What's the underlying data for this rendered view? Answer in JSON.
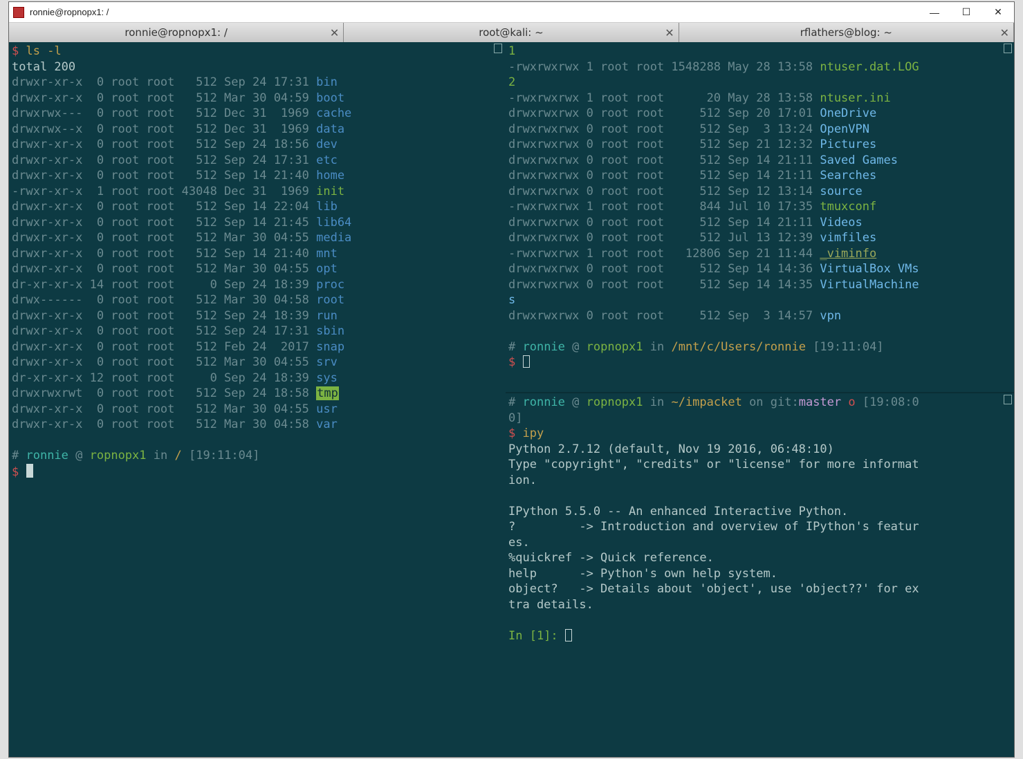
{
  "window": {
    "title": "ronnie@ropnopx1: /"
  },
  "tabs": [
    {
      "label": "ronnie@ropnopx1: /"
    },
    {
      "label": "root@kali: ~"
    },
    {
      "label": "rflathers@blog: ~"
    }
  ],
  "left": {
    "cmd": "ls -l",
    "total": "total 200",
    "rows": [
      {
        "perm": "drwxr-xr-x",
        "n": "0",
        "o": "root",
        "g": "root",
        "size": "512",
        "date": "Sep 24 17:31",
        "name": "bin",
        "cls": "c-blue"
      },
      {
        "perm": "drwxr-xr-x",
        "n": "0",
        "o": "root",
        "g": "root",
        "size": "512",
        "date": "Mar 30 04:59",
        "name": "boot",
        "cls": "c-blue"
      },
      {
        "perm": "drwxrwx---",
        "n": "0",
        "o": "root",
        "g": "root",
        "size": "512",
        "date": "Dec 31  1969",
        "name": "cache",
        "cls": "c-blue"
      },
      {
        "perm": "drwxrwx--x",
        "n": "0",
        "o": "root",
        "g": "root",
        "size": "512",
        "date": "Dec 31  1969",
        "name": "data",
        "cls": "c-blue"
      },
      {
        "perm": "drwxr-xr-x",
        "n": "0",
        "o": "root",
        "g": "root",
        "size": "512",
        "date": "Sep 24 18:56",
        "name": "dev",
        "cls": "c-blue"
      },
      {
        "perm": "drwxr-xr-x",
        "n": "0",
        "o": "root",
        "g": "root",
        "size": "512",
        "date": "Sep 24 17:31",
        "name": "etc",
        "cls": "c-blue"
      },
      {
        "perm": "drwxr-xr-x",
        "n": "0",
        "o": "root",
        "g": "root",
        "size": "512",
        "date": "Sep 14 21:40",
        "name": "home",
        "cls": "c-blue"
      },
      {
        "perm": "-rwxr-xr-x",
        "n": "1",
        "o": "root",
        "g": "root",
        "size": "43048",
        "date": "Dec 31  1969",
        "name": "init",
        "cls": "c-green"
      },
      {
        "perm": "drwxr-xr-x",
        "n": "0",
        "o": "root",
        "g": "root",
        "size": "512",
        "date": "Sep 14 22:04",
        "name": "lib",
        "cls": "c-blue"
      },
      {
        "perm": "drwxr-xr-x",
        "n": "0",
        "o": "root",
        "g": "root",
        "size": "512",
        "date": "Sep 14 21:45",
        "name": "lib64",
        "cls": "c-blue"
      },
      {
        "perm": "drwxr-xr-x",
        "n": "0",
        "o": "root",
        "g": "root",
        "size": "512",
        "date": "Mar 30 04:55",
        "name": "media",
        "cls": "c-blue"
      },
      {
        "perm": "drwxr-xr-x",
        "n": "0",
        "o": "root",
        "g": "root",
        "size": "512",
        "date": "Sep 14 21:40",
        "name": "mnt",
        "cls": "c-blue"
      },
      {
        "perm": "drwxr-xr-x",
        "n": "0",
        "o": "root",
        "g": "root",
        "size": "512",
        "date": "Mar 30 04:55",
        "name": "opt",
        "cls": "c-blue"
      },
      {
        "perm": "dr-xr-xr-x",
        "n": "14",
        "o": "root",
        "g": "root",
        "size": "0",
        "date": "Sep 24 18:39",
        "name": "proc",
        "cls": "c-blue"
      },
      {
        "perm": "drwx------",
        "n": "0",
        "o": "root",
        "g": "root",
        "size": "512",
        "date": "Mar 30 04:58",
        "name": "root",
        "cls": "c-blue"
      },
      {
        "perm": "drwxr-xr-x",
        "n": "0",
        "o": "root",
        "g": "root",
        "size": "512",
        "date": "Sep 24 18:39",
        "name": "run",
        "cls": "c-blue"
      },
      {
        "perm": "drwxr-xr-x",
        "n": "0",
        "o": "root",
        "g": "root",
        "size": "512",
        "date": "Sep 24 17:31",
        "name": "sbin",
        "cls": "c-blue"
      },
      {
        "perm": "drwxr-xr-x",
        "n": "0",
        "o": "root",
        "g": "root",
        "size": "512",
        "date": "Feb 24  2017",
        "name": "snap",
        "cls": "c-blue"
      },
      {
        "perm": "drwxr-xr-x",
        "n": "0",
        "o": "root",
        "g": "root",
        "size": "512",
        "date": "Mar 30 04:55",
        "name": "srv",
        "cls": "c-blue"
      },
      {
        "perm": "dr-xr-xr-x",
        "n": "12",
        "o": "root",
        "g": "root",
        "size": "0",
        "date": "Sep 24 18:39",
        "name": "sys",
        "cls": "c-blue"
      },
      {
        "perm": "drwxrwxrwt",
        "n": "0",
        "o": "root",
        "g": "root",
        "size": "512",
        "date": "Sep 24 18:58",
        "name": "tmp",
        "cls": "hl-tmp"
      },
      {
        "perm": "drwxr-xr-x",
        "n": "0",
        "o": "root",
        "g": "root",
        "size": "512",
        "date": "Mar 30 04:55",
        "name": "usr",
        "cls": "c-blue"
      },
      {
        "perm": "drwxr-xr-x",
        "n": "0",
        "o": "root",
        "g": "root",
        "size": "512",
        "date": "Mar 30 04:58",
        "name": "var",
        "cls": "c-blue"
      }
    ],
    "prompt": {
      "user": "ronnie",
      "host": "ropnopx1",
      "path": "/",
      "time": "[19:11:04]"
    }
  },
  "rightTop": {
    "wrap1": "1",
    "rows": [
      {
        "perm": "-rwxrwxrwx",
        "n": "1",
        "o": "root",
        "g": "root",
        "size": "1548288",
        "date": "May 28 13:58",
        "name": "ntuser.dat.LOG",
        "cls": "c-green",
        "wrap": "2"
      },
      {
        "perm": "-rwxrwxrwx",
        "n": "1",
        "o": "root",
        "g": "root",
        "size": "20",
        "date": "May 28 13:58",
        "name": "ntuser.ini",
        "cls": "c-green"
      },
      {
        "perm": "drwxrwxrwx",
        "n": "0",
        "o": "root",
        "g": "root",
        "size": "512",
        "date": "Sep 20 17:01",
        "name": "OneDrive",
        "cls": "c-lblue"
      },
      {
        "perm": "drwxrwxrwx",
        "n": "0",
        "o": "root",
        "g": "root",
        "size": "512",
        "date": "Sep  3 13:24",
        "name": "OpenVPN",
        "cls": "c-lblue"
      },
      {
        "perm": "drwxrwxrwx",
        "n": "0",
        "o": "root",
        "g": "root",
        "size": "512",
        "date": "Sep 21 12:32",
        "name": "Pictures",
        "cls": "c-lblue"
      },
      {
        "perm": "drwxrwxrwx",
        "n": "0",
        "o": "root",
        "g": "root",
        "size": "512",
        "date": "Sep 14 21:11",
        "name": "Saved Games",
        "cls": "c-lblue"
      },
      {
        "perm": "drwxrwxrwx",
        "n": "0",
        "o": "root",
        "g": "root",
        "size": "512",
        "date": "Sep 14 21:11",
        "name": "Searches",
        "cls": "c-lblue"
      },
      {
        "perm": "drwxrwxrwx",
        "n": "0",
        "o": "root",
        "g": "root",
        "size": "512",
        "date": "Sep 12 13:14",
        "name": "source",
        "cls": "c-lblue"
      },
      {
        "perm": "-rwxrwxrwx",
        "n": "1",
        "o": "root",
        "g": "root",
        "size": "844",
        "date": "Jul 10 17:35",
        "name": "tmuxconf",
        "cls": "c-green"
      },
      {
        "perm": "drwxrwxrwx",
        "n": "0",
        "o": "root",
        "g": "root",
        "size": "512",
        "date": "Sep 14 21:11",
        "name": "Videos",
        "cls": "c-lblue"
      },
      {
        "perm": "drwxrwxrwx",
        "n": "0",
        "o": "root",
        "g": "root",
        "size": "512",
        "date": "Jul 13 12:39",
        "name": "vimfiles",
        "cls": "c-lblue"
      },
      {
        "perm": "-rwxrwxrwx",
        "n": "1",
        "o": "root",
        "g": "root",
        "size": "12806",
        "date": "Sep 21 11:44",
        "name": "_viminfo",
        "cls": "c-olive",
        "under": true
      },
      {
        "perm": "drwxrwxrwx",
        "n": "0",
        "o": "root",
        "g": "root",
        "size": "512",
        "date": "Sep 14 14:36",
        "name": "VirtualBox VMs",
        "cls": "c-lblue"
      },
      {
        "perm": "drwxrwxrwx",
        "n": "0",
        "o": "root",
        "g": "root",
        "size": "512",
        "date": "Sep 14 14:35",
        "name": "VirtualMachine",
        "cls": "c-lblue",
        "wrap": "s"
      },
      {
        "perm": "drwxrwxrwx",
        "n": "0",
        "o": "root",
        "g": "root",
        "size": "512",
        "date": "Sep  3 14:57",
        "name": "vpn",
        "cls": "c-lblue"
      }
    ],
    "prompt": {
      "user": "ronnie",
      "host": "ropnopx1",
      "path": "/mnt/c/Users/ronnie",
      "time": "[19:11:04]"
    }
  },
  "rightBottom": {
    "prompt": {
      "user": "ronnie",
      "host": "ropnopx1",
      "path": "~/impacket",
      "branch": "master",
      "flag": "o",
      "time": "[19:08:0",
      "timeWrap": "0]"
    },
    "cmd": "ipy",
    "lines": [
      "Python 2.7.12 (default, Nov 19 2016, 06:48:10)",
      "Type \"copyright\", \"credits\" or \"license\" for more informat",
      "ion.",
      "",
      "IPython 5.5.0 -- An enhanced Interactive Python.",
      "?         -> Introduction and overview of IPython's featur",
      "es.",
      "%quickref -> Quick reference.",
      "help      -> Python's own help system.",
      "object?   -> Details about 'object', use 'object??' for ex",
      "tra details."
    ],
    "inPrompt": "In [1]: "
  }
}
